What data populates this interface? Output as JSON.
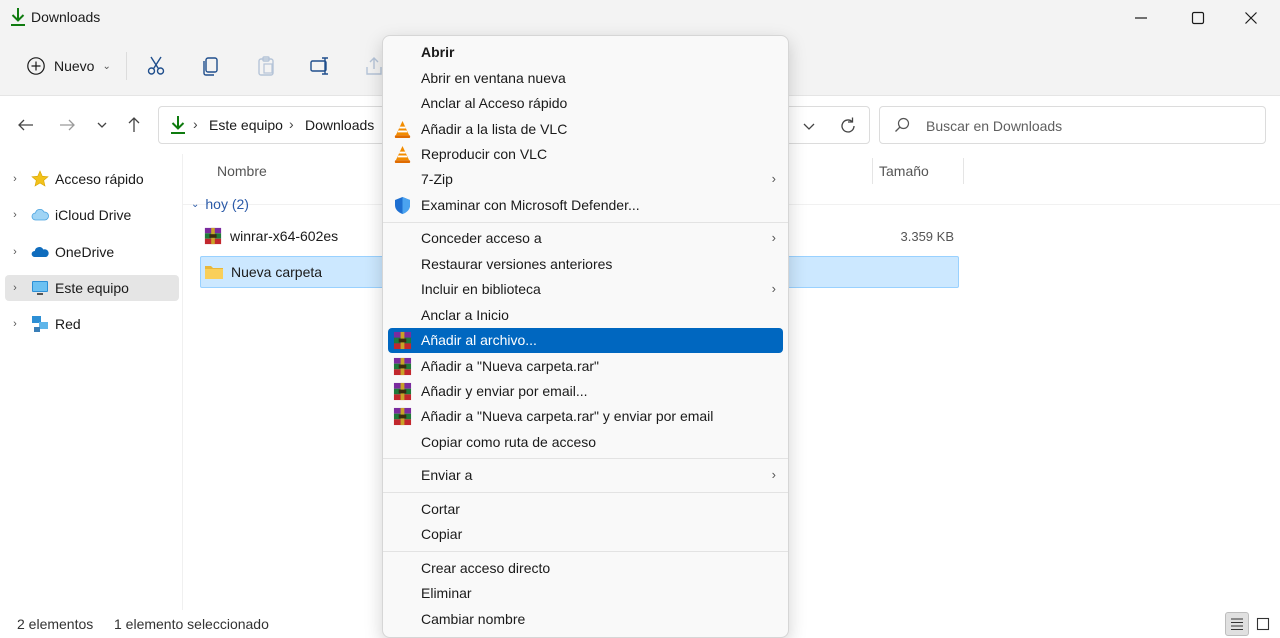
{
  "window": {
    "title": "Downloads"
  },
  "commandbar": {
    "new_label": "Nuevo",
    "tools": [
      "cut-icon",
      "copy-icon",
      "paste-icon",
      "rename-icon",
      "share-icon"
    ]
  },
  "address": {
    "crumbs": [
      "Este equipo",
      "Downloads"
    ],
    "search_placeholder": "Buscar en Downloads"
  },
  "sidebar": {
    "items": [
      {
        "label": "Acceso rápido",
        "icon": "star-icon"
      },
      {
        "label": "iCloud Drive",
        "icon": "icloud-icon"
      },
      {
        "label": "OneDrive",
        "icon": "onedrive-icon"
      },
      {
        "label": "Este equipo",
        "icon": "computer-icon",
        "selected": true
      },
      {
        "label": "Red",
        "icon": "network-icon"
      }
    ]
  },
  "filelist": {
    "columns": {
      "name": "Nombre",
      "size": "Tamaño"
    },
    "group_label": "hoy (2)",
    "files": [
      {
        "name": "winrar-x64-602es",
        "size": "3.359 KB",
        "icon": "winrar-icon"
      },
      {
        "name": "Nueva carpeta",
        "size": "",
        "icon": "folder-icon",
        "selected": true
      }
    ]
  },
  "status": {
    "count": "2 elementos",
    "selection": "1 elemento seleccionado"
  },
  "context_menu": {
    "items": [
      {
        "label": "Abrir",
        "bold": true
      },
      {
        "label": "Abrir en ventana nueva"
      },
      {
        "label": "Anclar al Acceso rápido"
      },
      {
        "label": "Añadir a la lista de VLC",
        "icon": "vlc-icon"
      },
      {
        "label": "Reproducir con VLC",
        "icon": "vlc-icon"
      },
      {
        "label": "7-Zip",
        "submenu": true
      },
      {
        "label": "Examinar con Microsoft Defender...",
        "icon": "defender-shield-icon"
      },
      {
        "label": "Conceder acceso a",
        "submenu": true
      },
      {
        "label": "Restaurar versiones anteriores"
      },
      {
        "label": "Incluir en biblioteca",
        "submenu": true
      },
      {
        "label": "Anclar a Inicio"
      },
      {
        "label": "Añadir al archivo...",
        "icon": "winrar-icon",
        "highlighted": true
      },
      {
        "label": "Añadir a \"Nueva carpeta.rar\"",
        "icon": "winrar-icon"
      },
      {
        "label": "Añadir y enviar por email...",
        "icon": "winrar-icon"
      },
      {
        "label": "Añadir a \"Nueva carpeta.rar\" y enviar por email",
        "icon": "winrar-icon"
      },
      {
        "label": "Copiar como ruta de acceso"
      },
      {
        "label": "Enviar a",
        "submenu": true
      },
      {
        "label": "Cortar"
      },
      {
        "label": "Copiar"
      },
      {
        "label": "Crear acceso directo"
      },
      {
        "label": "Eliminar"
      },
      {
        "label": "Cambiar nombre"
      }
    ]
  },
  "colors": {
    "accent": "#0067c0",
    "selection": "#cce8ff",
    "download_green": "#0f7b0f"
  }
}
